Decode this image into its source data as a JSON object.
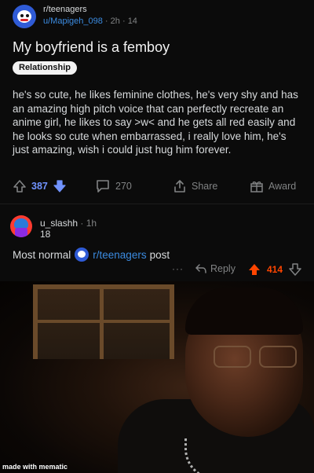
{
  "post": {
    "subreddit": "r/teenagers",
    "user": "u/Mapigeh_098",
    "time": "2h",
    "extra": "14",
    "title": "My boyfriend is a femboy",
    "flair": "Relationship",
    "body": "he's so cute, he likes feminine clothes, he's very shy and has an amazing high pitch voice that can perfectly recreate an anime girl, he likes to say >w< and he gets all red easily and he looks so cute when embarrassed, i really love him, he's just amazing, wish i could just hug him forever.",
    "score": "387",
    "comments": "270",
    "share_label": "Share",
    "award_label": "Award"
  },
  "comment": {
    "user": "u_slashh",
    "time": "1h",
    "flair": "18",
    "text_before": "Most normal",
    "sub_link": "r/teenagers",
    "text_after": "post",
    "dots": "···",
    "reply_label": "Reply",
    "score": "414"
  },
  "meme": {
    "watermark": "made with mematic"
  },
  "colors": {
    "upvote_blue": "#7193ff",
    "upvote_orange": "#ff4500",
    "link_blue": "#3b8be0"
  }
}
